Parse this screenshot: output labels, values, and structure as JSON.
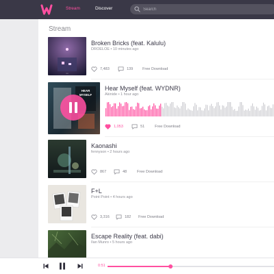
{
  "nav": {
    "stream": "Stream",
    "discover": "Discover",
    "search_placeholder": "Search"
  },
  "main": {
    "heading": "Stream",
    "free_download": "Free Download",
    "tracks": [
      {
        "title": "Broken Bricks (feat. Kalulu)",
        "meta": "DROELOE • 10 minutes ago",
        "likes": "7,483",
        "comments": "139",
        "liked": false
      },
      {
        "title": "Hear Myself (feat. WYDNR)",
        "meta": "Akinide • 1 hour ago",
        "likes": "1,053",
        "comments": "51",
        "liked": true,
        "playing": true
      },
      {
        "title": "Kaonashi",
        "meta": "fennyson • 2 hours ago",
        "likes": "867",
        "comments": "48",
        "liked": false
      },
      {
        "title": "F+L",
        "meta": "Point Point • 4 hours ago",
        "likes": "3,316",
        "comments": "182",
        "liked": false
      },
      {
        "title": "Escape Reality (feat. dabi)",
        "meta": "Ilan Munro • 5 hours ago"
      }
    ]
  },
  "player": {
    "elapsed": "0:51",
    "progress": 0.38
  },
  "colors": {
    "accent": "#ff4fa0",
    "topbar": "#3a3847",
    "background": "#ececee",
    "panel": "#ffffff"
  },
  "icons": [
    "logo-w-icon",
    "search-icon",
    "heart-icon",
    "comment-icon",
    "pause-icon",
    "previous-icon",
    "next-icon"
  ]
}
